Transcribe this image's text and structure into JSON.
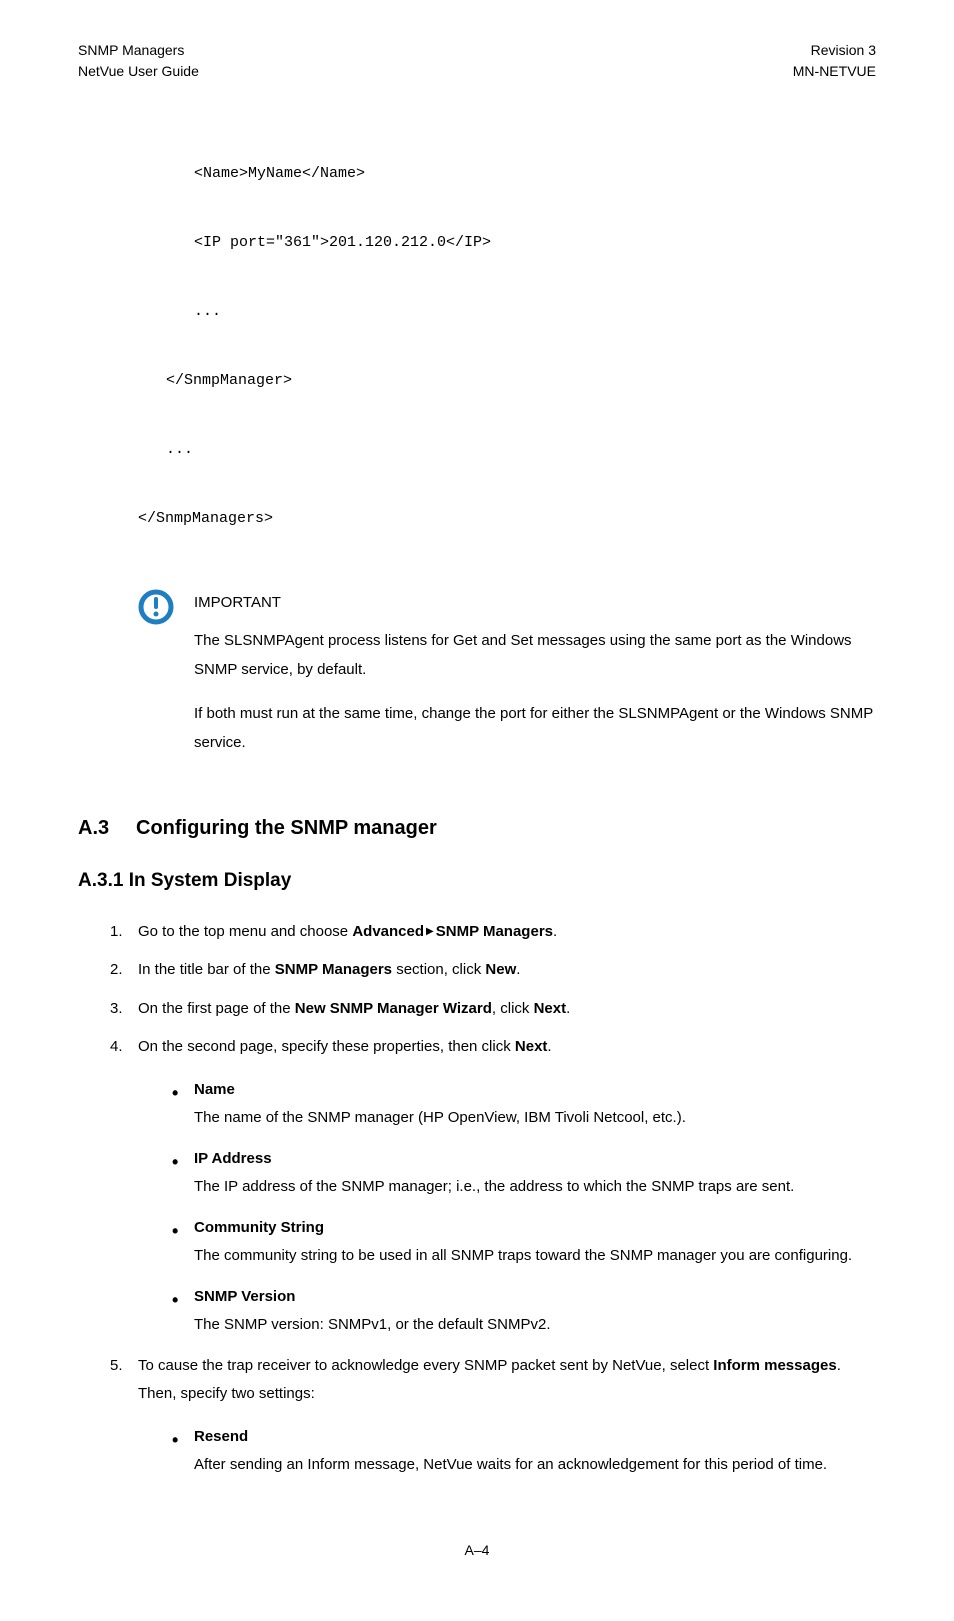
{
  "header": {
    "left1": "SNMP Managers",
    "left2": "NetVue User Guide",
    "right1": "Revision 3",
    "right2": "MN-NETVUE"
  },
  "code": {
    "l1": "<Name>MyName</Name>",
    "l2": "<IP port=\"361\">201.120.212.0</IP>",
    "l3": "...",
    "l4": "</SnmpManager>",
    "l5": "...",
    "l6": "</SnmpManagers>"
  },
  "important": {
    "title": "IMPORTANT",
    "p1": "The SLSNMPAgent process listens for Get and Set messages using the same port as the Windows SNMP service, by default.",
    "p2": "If both must run at the same time, change the port for either the SLSNMPAgent or the Windows SNMP service."
  },
  "section": {
    "num": "A.3",
    "title": "Configuring the SNMP manager"
  },
  "subsection": {
    "title": "A.3.1 In System Display"
  },
  "steps": {
    "s1a": "Go to the top menu and choose ",
    "s1b": "Advanced",
    "s1c": "SNMP Managers",
    "s1d": ".",
    "s2a": "In the title bar of the ",
    "s2b": "SNMP Managers",
    "s2c": " section, click ",
    "s2d": "New",
    "s2e": ".",
    "s3a": "On the first page of the ",
    "s3b": "New SNMP Manager Wizard",
    "s3c": ", click ",
    "s3d": "Next",
    "s3e": ".",
    "s4a": "On the second page, specify these properties, then click ",
    "s4b": "Next",
    "s4c": ".",
    "s5a": "To cause the trap receiver to acknowledge every SNMP packet sent by NetVue, select ",
    "s5b": "Inform messages",
    "s5c": ". Then, specify two settings:"
  },
  "props4": {
    "p1n": "Name",
    "p1d": "The name of the SNMP manager (HP OpenView, IBM Tivoli Netcool, etc.).",
    "p2n": "IP Address",
    "p2d": "The IP address of the SNMP manager; i.e., the address to which the SNMP traps are sent.",
    "p3n": "Community String",
    "p3d": "The community string to be used in all SNMP traps toward the SNMP manager you are configuring.",
    "p4n": "SNMP Version",
    "p4d": "The SNMP version: SNMPv1, or the default SNMPv2."
  },
  "props5": {
    "p1n": "Resend",
    "p1d": "After sending an Inform message, NetVue waits for an acknowledgement for this period of time."
  },
  "footer": "A–4"
}
